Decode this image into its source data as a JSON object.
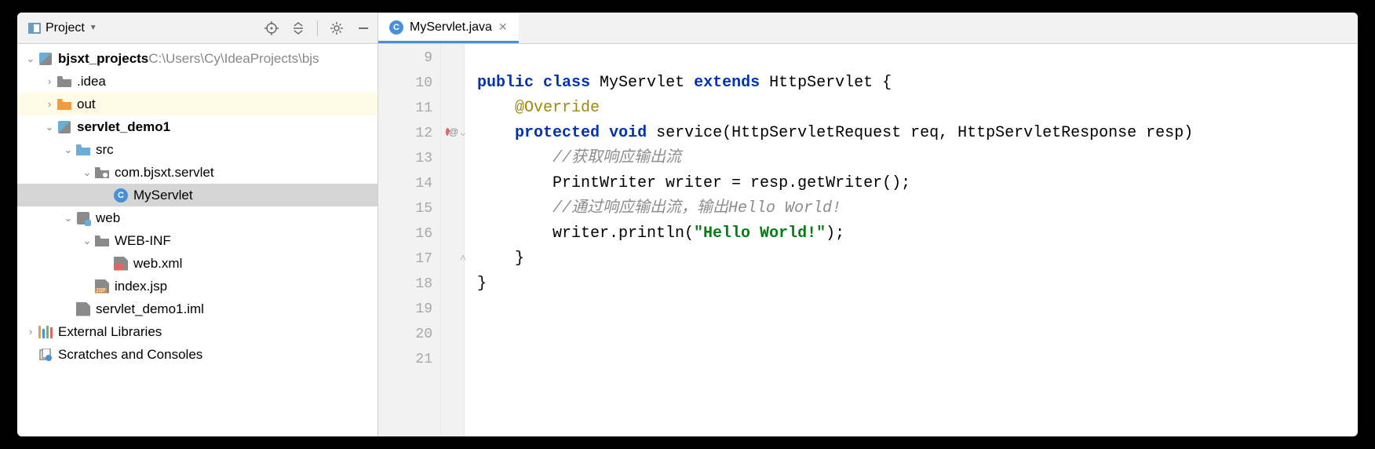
{
  "sidebar": {
    "title": "Project",
    "root": {
      "name": "bjsxt_projects",
      "path": " C:\\Users\\Cy\\IdeaProjects\\bjs"
    },
    "folders": {
      "idea": ".idea",
      "out": "out",
      "servlet_demo1": "servlet_demo1",
      "src": "src",
      "package": "com.bjsxt.servlet",
      "myservlet": "MyServlet",
      "web": "web",
      "webinf": "WEB-INF",
      "webxml": "web.xml",
      "indexjsp": "index.jsp",
      "iml": "servlet_demo1.iml",
      "extlib": "External Libraries",
      "scratches": "Scratches and Consoles"
    }
  },
  "tab": {
    "filename": "MyServlet.java"
  },
  "gutter": {
    "start": 9,
    "lines": [
      "9",
      "10",
      "11",
      "12",
      "13",
      "14",
      "15",
      "16",
      "17",
      "18",
      "19",
      "20",
      "21"
    ]
  },
  "code": {
    "l10": {
      "p1": "public",
      "p2": "class",
      "p3": " MyServlet ",
      "p4": "extends",
      "p5": " HttpServlet {"
    },
    "l11": {
      "anno": "@Override"
    },
    "l12": {
      "p1": "protected",
      "p2": "void",
      "p3": " service(HttpServletRequest req, HttpServletResponse resp)"
    },
    "l13": {
      "c": "//获取响应输出流"
    },
    "l14": {
      "t": "PrintWriter writer = resp.getWriter();"
    },
    "l15": {
      "c": "//通过响应输出流，输出Hello World!"
    },
    "l16": {
      "t1": "writer.println(",
      "s": "\"Hello World!\"",
      "t2": ");"
    },
    "l17": {
      "t": "}"
    },
    "l18": {
      "t": "}"
    }
  }
}
